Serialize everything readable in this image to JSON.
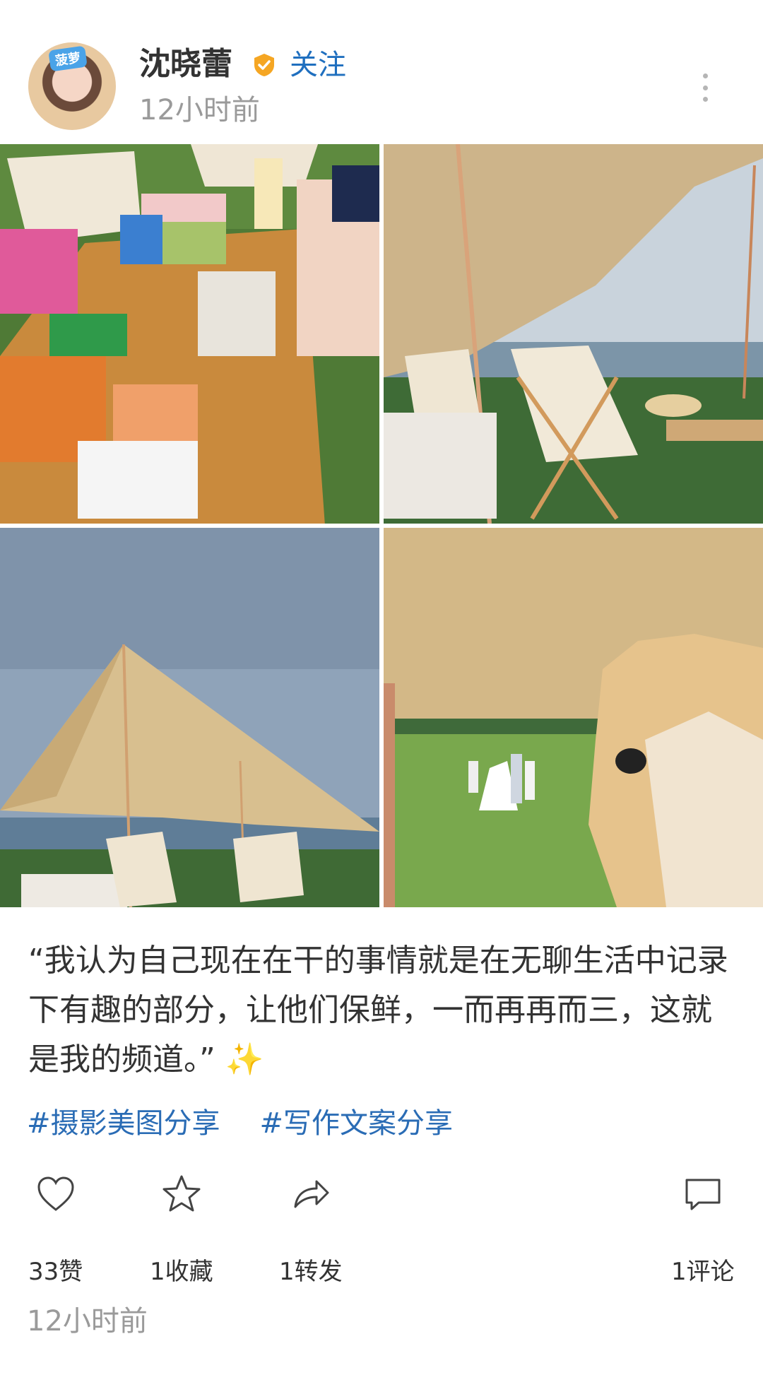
{
  "header": {
    "avatar_sticker": "菠萝",
    "username": "沈晓蕾",
    "follow_label": "关注",
    "time": "12小时前"
  },
  "post": {
    "caption": "“我认为自己现在在干的事情就是在无聊生活中记录下有趣的部分，让他们保鲜，一而再再而三，这就是我的频道。”",
    "sparkle": "✨",
    "tags": [
      "#摄影美图分享",
      "#写作文案分享"
    ],
    "photos": [
      "picnic-table-snacks",
      "canopy-chairs-sea",
      "canopy-sky-wide",
      "wedding-on-lawn-hat"
    ]
  },
  "actions": {
    "like": "33赞",
    "favorite": "1收藏",
    "share": "1转发",
    "comment": "1评论"
  },
  "footer": {
    "time": "12小时前"
  },
  "colors": {
    "link": "#2a6cb5",
    "follow": "#1f6fbf",
    "muted": "#9a9a9a",
    "verified": "#f5a623"
  }
}
